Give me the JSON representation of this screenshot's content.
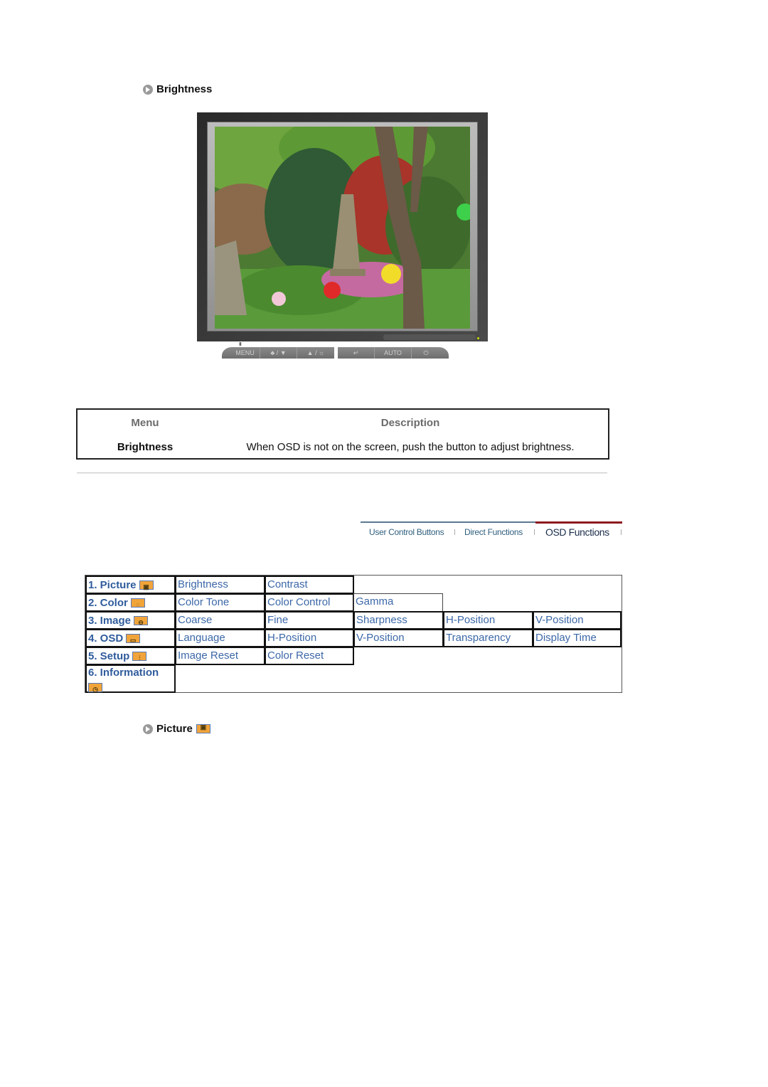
{
  "section1": {
    "title": "Brightness",
    "icon": "arrow-circle-icon"
  },
  "monitor_buttons": [
    {
      "label": "MENU",
      "icon": "menu-icon"
    },
    {
      "label": "♣ / ▼",
      "icon": "magicbright-down-icon"
    },
    {
      "label": "▲ / ☼",
      "icon": "up-brightness-icon"
    },
    {
      "label": "↵",
      "icon": "enter-icon"
    },
    {
      "label": "AUTO",
      "icon": "auto-icon"
    },
    {
      "label": "⏻",
      "icon": "power-icon"
    }
  ],
  "menu_indicator": "III",
  "description_table": {
    "headers": {
      "menu": "Menu",
      "description": "Description"
    },
    "rows": [
      {
        "menu": "Brightness",
        "description": "When OSD is not on the screen, push the button to adjust brightness."
      }
    ]
  },
  "tabs": [
    {
      "label": "User Control Buttons",
      "active": false
    },
    {
      "label": "Direct Functions",
      "active": false
    },
    {
      "label": "OSD Functions",
      "active": true
    }
  ],
  "colors": {
    "link_blue": "#3c68a8",
    "active_tab_bar": "#8d1a1f",
    "icon_orange": "#f0a43a"
  },
  "osd_menu": {
    "categories": [
      {
        "label": "1. Picture",
        "icon": "picture-icon",
        "glyph": "▣",
        "items": [
          "Brightness",
          "Contrast"
        ]
      },
      {
        "label": "2. Color",
        "icon": "color-icon",
        "glyph": "◌",
        "items": [
          "Color Tone",
          "Color Control",
          "Gamma"
        ]
      },
      {
        "label": "3. Image",
        "icon": "image-icon",
        "glyph": "⊖",
        "items": [
          "Coarse",
          "Fine",
          "Sharpness",
          "H-Position",
          "V-Position"
        ]
      },
      {
        "label": "4. OSD",
        "icon": "osd-icon",
        "glyph": "▭",
        "items": [
          "Language",
          "H-Position",
          "V-Position",
          "Transparency",
          "Display Time"
        ]
      },
      {
        "label": "5. Setup",
        "icon": "setup-icon",
        "glyph": "⫶",
        "items": [
          "Image Reset",
          "Color Reset"
        ]
      },
      {
        "label": "6. Information",
        "icon": "information-icon",
        "glyph": "◷",
        "items": []
      }
    ]
  },
  "section2": {
    "title": "Picture",
    "icon": "arrow-circle-icon",
    "badge_icon": "picture-icon",
    "badge_glyph": "▣"
  }
}
